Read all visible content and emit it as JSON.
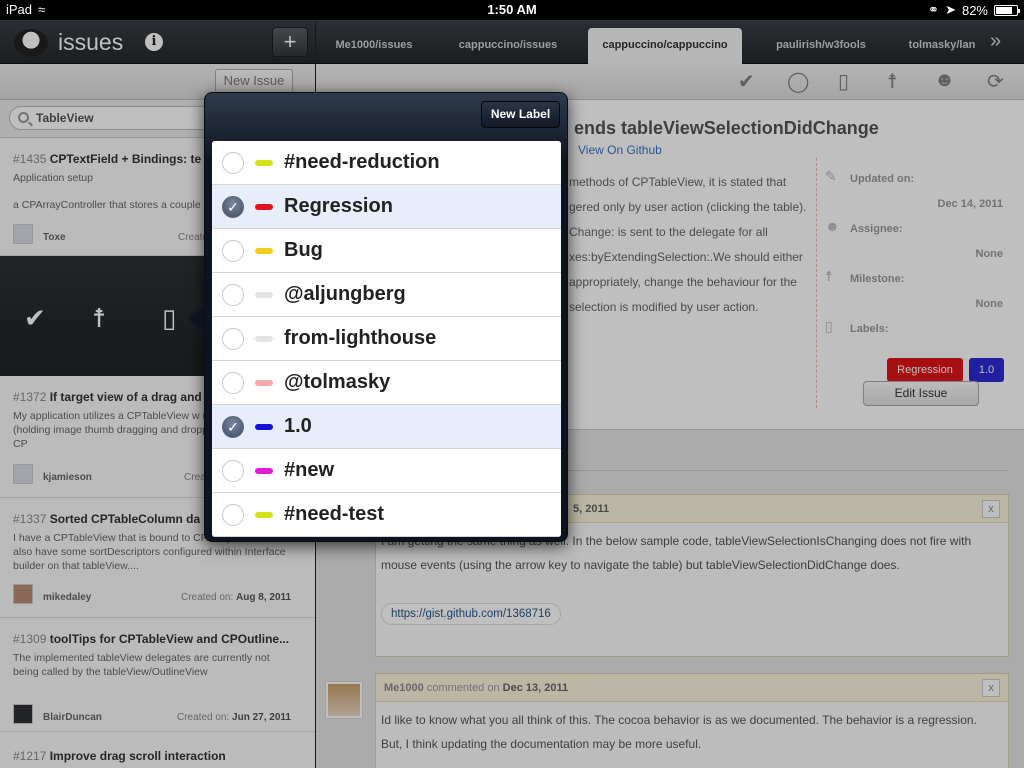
{
  "status": {
    "device": "iPad",
    "time": "1:50 AM",
    "battery": "82%",
    "battery_level": 0.82
  },
  "left": {
    "app_title": "issues",
    "new_issue_label": "New Issue",
    "search_value": "TableView",
    "issues": [
      {
        "num": "#1435",
        "title": "CPTextField + Bindings: te",
        "line1": "Application setup",
        "line2": "a CPArrayController that stores a couple",
        "user": "Toxe",
        "created_label": "Create",
        "created_date": ""
      },
      {
        "num": "#1372",
        "title": "If target view of a drag and",
        "desc": "My application utilizes a CPTableView w (height-wise) rows (holding image thumb dragging and dropping rows within a CP",
        "user": "kjamieson",
        "created_label": "Crea",
        "created_date": ""
      },
      {
        "num": "#1337",
        "title": "Sorted CPTableColumn da",
        "desc": "I have a CPTableView that is bound to CPArrayController. I also have some sortDescriptors configured within Interface builder on that tableView....",
        "user": "mikedaley",
        "created_label": "Created on:",
        "created_date": "Aug 8, 2011"
      },
      {
        "num": "#1309",
        "title": "toolTips for CPTableView and CPOutline...",
        "desc": "The implemented tableView delegates are currently not being called by the tableView/OutlineView",
        "user": "BlairDuncan",
        "created_label": "Created on:",
        "created_date": "Jun 27, 2011"
      },
      {
        "num": "#1217",
        "title": "Improve drag scroll interaction"
      }
    ]
  },
  "right": {
    "tabs": [
      "Me1000/issues",
      "cappuccino/issues",
      "cappuccino/cappuccino",
      "paulirish/w3fools",
      "tolmasky/lan"
    ],
    "detail": {
      "title": "ends tableViewSelectionDidChange",
      "github_link": "View On Github",
      "body": "methods of CPTableView, it is stated that gered only by user action (clicking the table). Change: is sent to the delegate for all xes:byExtendingSelection:.We should either appropriately, change the behaviour for the selection is modified by user action.",
      "updated_label": "Updated on:",
      "updated_value": "Dec 14, 2011",
      "assignee_label": "Assignee:",
      "assignee_value": "None",
      "milestone_label": "Milestone:",
      "milestone_value": "None",
      "labels_label": "Labels:",
      "labels": [
        {
          "name": "Regression",
          "color": "#e0141a"
        },
        {
          "name": "1.0",
          "color": "#2a2ad6"
        }
      ],
      "edit_label": "Edit Issue"
    },
    "comments": [
      {
        "date": "5, 2011",
        "text": "I am getting the same thing as well. In the below sample code, tableViewSelectionIsChanging does not fire with mouse events (using the arrow key to navigate the table) but tableViewSelectionDidChange does.",
        "link": "https://gist.github.com/1368716",
        "close": "x"
      },
      {
        "user": "Me1000",
        "commented_on": "commented on",
        "date": "Dec 13, 2011",
        "text": "Id like to know what you all think of this. The cocoa behavior is as we documented. The behavior is a regression. But, I think updating the documentation may be more useful.",
        "close": "x"
      }
    ]
  },
  "popover": {
    "new_label_button": "New Label",
    "labels": [
      {
        "name": "#need-reduction",
        "color": "#d6e01c",
        "checked": false
      },
      {
        "name": "Regression",
        "color": "#e0141a",
        "checked": true
      },
      {
        "name": "Bug",
        "color": "#f2cf1c",
        "checked": false
      },
      {
        "name": "@aljungberg",
        "color": "#e4e4e4",
        "checked": false
      },
      {
        "name": "from-lighthouse",
        "color": "#e4e4e4",
        "checked": false
      },
      {
        "name": "@tolmasky",
        "color": "#f2aaa6",
        "checked": false
      },
      {
        "name": "1.0",
        "color": "#1212d8",
        "checked": true
      },
      {
        "name": "#new",
        "color": "#e01ad6",
        "checked": false
      },
      {
        "name": "#need-test",
        "color": "#d6e01c",
        "checked": false
      }
    ]
  }
}
